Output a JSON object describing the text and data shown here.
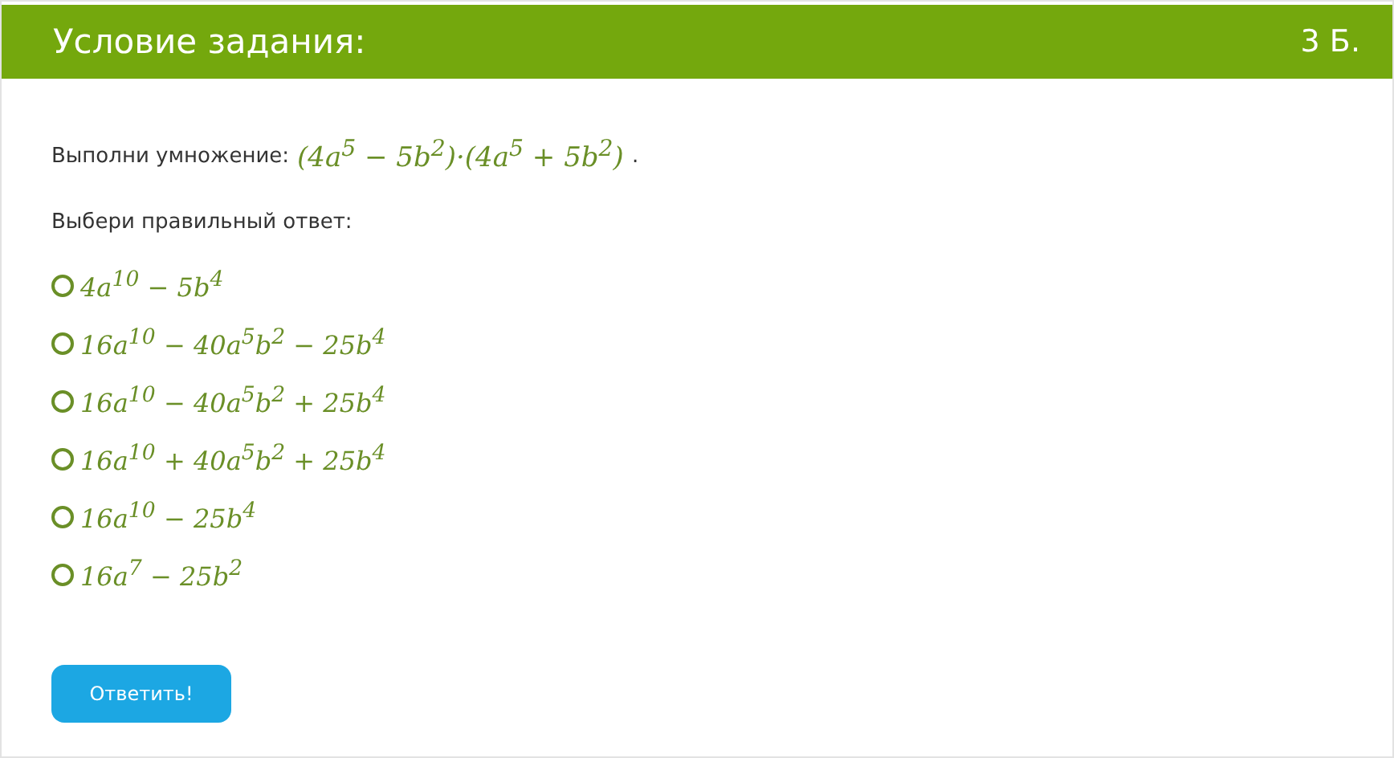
{
  "header": {
    "title": "Условие задания:",
    "points": "3 Б."
  },
  "task": {
    "prompt": "Выполни умножение:",
    "expression": "(4a$^{5}$ − 5b$^{2}$)·(4a$^{5}$ + 5b$^{2}$)",
    "end": "."
  },
  "instruction": "Выбери правильный ответ:",
  "options": [
    {
      "text": "4a$^{10}$ − 5b$^{4}$",
      "selected": false
    },
    {
      "text": "16a$^{10}$ − 40a$^{5}$b$^{2}$ − 25b$^{4}$",
      "selected": false
    },
    {
      "text": "16a$^{10}$ − 40a$^{5}$b$^{2}$ + 25b$^{4}$",
      "selected": false
    },
    {
      "text": "16a$^{10}$ + 40a$^{5}$b$^{2}$ + 25b$^{4}$",
      "selected": false
    },
    {
      "text": "16a$^{10}$ − 25b$^{4}$",
      "selected": false
    },
    {
      "text": "16a$^{7}$ − 25b$^{2}$",
      "selected": false
    }
  ],
  "submit": "Ответить!"
}
